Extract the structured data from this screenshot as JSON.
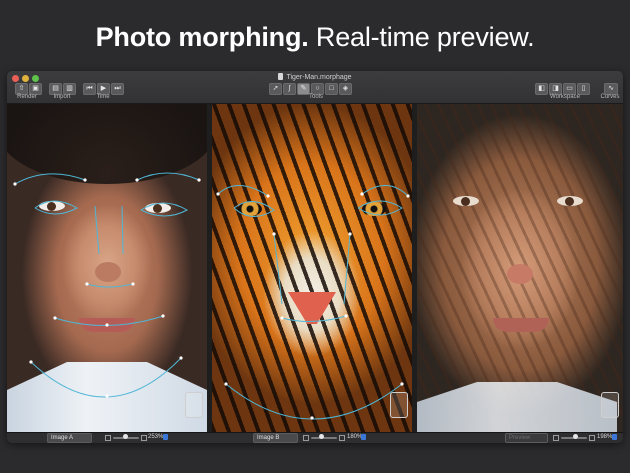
{
  "headline": {
    "bold": "Photo morphing.",
    "light": "Real-time preview."
  },
  "window": {
    "title": "Tiger-Man.morphage"
  },
  "toolbar": {
    "render_label": "Render",
    "import_label": "Import",
    "time_label": "Time",
    "tools_label": "Tools",
    "workspace_label": "Workspace",
    "curves_label": "Curves"
  },
  "panels": {
    "a": {
      "selector": "Image A",
      "zoom": "253%"
    },
    "b": {
      "selector": "Image B",
      "zoom": "180%"
    },
    "c": {
      "selector": "Preview",
      "zoom": "198%"
    }
  },
  "colors": {
    "accent": "#3b77d9",
    "background": "#2b2b2d"
  }
}
